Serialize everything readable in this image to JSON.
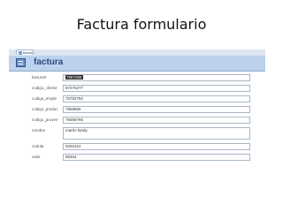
{
  "slide": {
    "title": "Factura formulario"
  },
  "window": {
    "tab_label": "factura",
    "form_title": "factura"
  },
  "fields": [
    {
      "label": "factura#",
      "value": "7867265"
    },
    {
      "label": "codigo_cliente",
      "value": "57275277"
    },
    {
      "label": "codigo_emple",
      "value": "75752752"
    },
    {
      "label": "codigo_produc",
      "value": "7869656"
    },
    {
      "label": "codigo_provee",
      "value": "76586786"
    },
    {
      "label": "nombre",
      "value": "martin fandy"
    },
    {
      "label": "cedula",
      "value": "5252422"
    },
    {
      "label": "valor",
      "value": "86454"
    }
  ]
}
